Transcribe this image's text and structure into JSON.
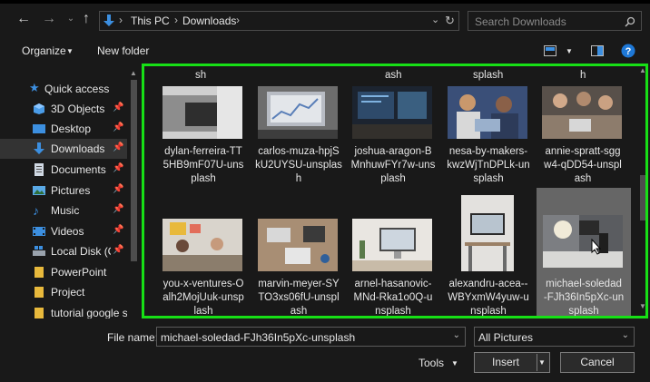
{
  "address": {
    "crumbs": [
      "This PC",
      "Downloads"
    ]
  },
  "search": {
    "placeholder": "Search Downloads"
  },
  "toolbar": {
    "organize": "Organize",
    "new_folder": "New folder"
  },
  "sidebar": {
    "items": [
      {
        "label": "Quick access",
        "icon": "star-icon"
      },
      {
        "label": "3D Objects",
        "icon": "cube-icon"
      },
      {
        "label": "Desktop",
        "icon": "desktop-icon"
      },
      {
        "label": "Downloads",
        "icon": "download-icon"
      },
      {
        "label": "Documents",
        "icon": "document-icon"
      },
      {
        "label": "Pictures",
        "icon": "pictures-icon"
      },
      {
        "label": "Music",
        "icon": "music-icon"
      },
      {
        "label": "Videos",
        "icon": "video-icon"
      },
      {
        "label": "Local Disk (C:",
        "icon": "disk-icon"
      },
      {
        "label": "PowerPoint",
        "icon": "folder-icon"
      },
      {
        "label": "Project",
        "icon": "folder-icon"
      },
      {
        "label": "tutorial google s",
        "icon": "folder-icon"
      }
    ]
  },
  "content": {
    "top_labels": [
      "sh",
      "ash",
      "splash",
      "h"
    ],
    "files": [
      {
        "name": "dylan-ferreira-TT5HB9mF07U-unsplash",
        "lines": [
          "dylan-ferreira-TT",
          "5HB9mF07U-uns",
          "plash"
        ]
      },
      {
        "name": "carlos-muza-hpjSkU2UYSU-unsplash",
        "lines": [
          "carlos-muza-hpjS",
          "kU2UYSU-unsplas",
          "h"
        ]
      },
      {
        "name": "joshua-aragon-BMnhuwFYr7w-unsplash",
        "lines": [
          "joshua-aragon-B",
          "MnhuwFYr7w-uns",
          "plash"
        ]
      },
      {
        "name": "nesa-by-makers-kwzWjTnDPLk-unsplash",
        "lines": [
          "nesa-by-makers-",
          "kwzWjTnDPLk-un",
          "splash"
        ]
      },
      {
        "name": "annie-spratt-sggw4-qDD54-unsplash",
        "lines": [
          "annie-spratt-sgg",
          "w4-qDD54-unspl",
          "ash"
        ]
      },
      {
        "name": "you-x-ventures-Oalh2MojUuk-unsplash",
        "lines": [
          "you-x-ventures-O",
          "alh2MojUuk-unsp",
          "lash"
        ]
      },
      {
        "name": "marvin-meyer-SYTO3xs06fU-unsplash",
        "lines": [
          "marvin-meyer-SY",
          "TO3xs06fU-unspl",
          "ash"
        ]
      },
      {
        "name": "arnel-hasanovic-MNd-Rka1o0Q-unsplash",
        "lines": [
          "arnel-hasanovic-",
          "MNd-Rka1o0Q-u",
          "nsplash"
        ]
      },
      {
        "name": "alexandru-acea--WBYxmW4yuw-unsplash",
        "lines": [
          "alexandru-acea--",
          "WBYxmW4yuw-u",
          "nsplash"
        ]
      },
      {
        "name": "michael-soledad-FJh36In5pXc-unsplash",
        "lines": [
          "michael-soledad",
          "-FJh36In5pXc-un",
          "splash"
        ]
      }
    ]
  },
  "footer": {
    "file_name_label": "File name:",
    "file_name_value": "michael-soledad-FJh36In5pXc-unsplash",
    "file_type": "All Pictures",
    "tools": "Tools",
    "insert": "Insert",
    "cancel": "Cancel"
  },
  "colors": {
    "accent_border": "#17e016",
    "folder": "#e8b93c",
    "blue_icon": "#3c8fe0"
  }
}
